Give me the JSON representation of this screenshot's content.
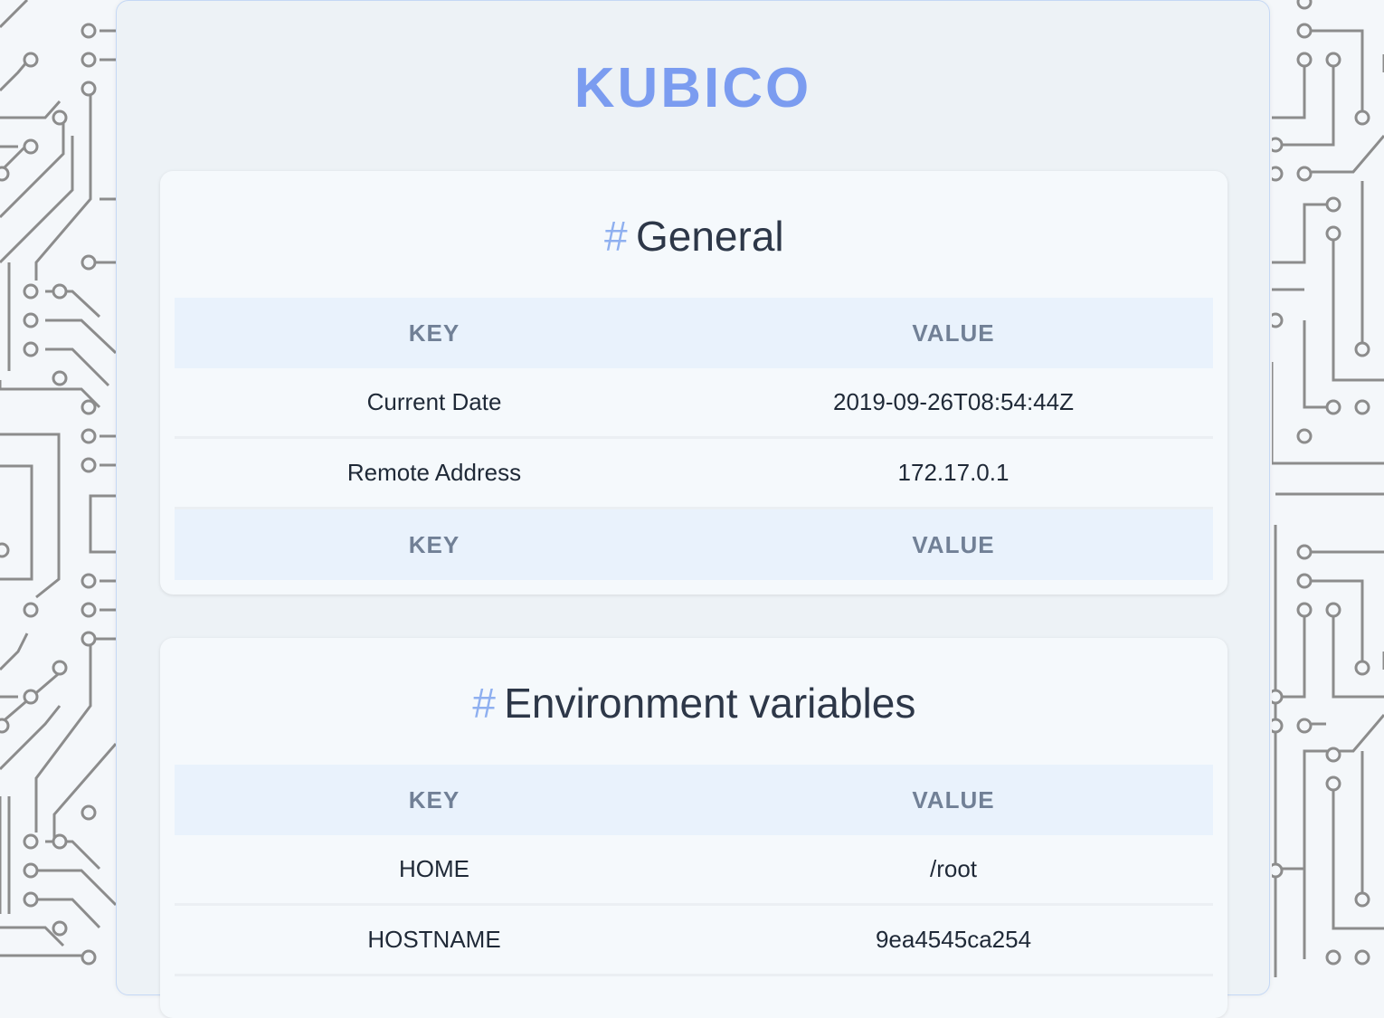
{
  "brand": "KUBICO",
  "hash_symbol": "#",
  "general": {
    "title": "General",
    "header": {
      "key": "KEY",
      "value": "VALUE"
    },
    "rows": [
      {
        "key": "Current Date",
        "value": "2019-09-26T08:54:44Z"
      },
      {
        "key": "Remote Address",
        "value": "172.17.0.1"
      }
    ],
    "footer": {
      "key": "KEY",
      "value": "VALUE"
    }
  },
  "env": {
    "title": "Environment variables",
    "header": {
      "key": "KEY",
      "value": "VALUE"
    },
    "rows": [
      {
        "key": "HOME",
        "value": "/root"
      },
      {
        "key": "HOSTNAME",
        "value": "9ea4545ca254"
      }
    ]
  },
  "colors": {
    "brand": "#7b9cf0",
    "hash": "#8fb0f0",
    "header_bg": "#e9f2fc",
    "circuit": "#8c8c8c"
  }
}
